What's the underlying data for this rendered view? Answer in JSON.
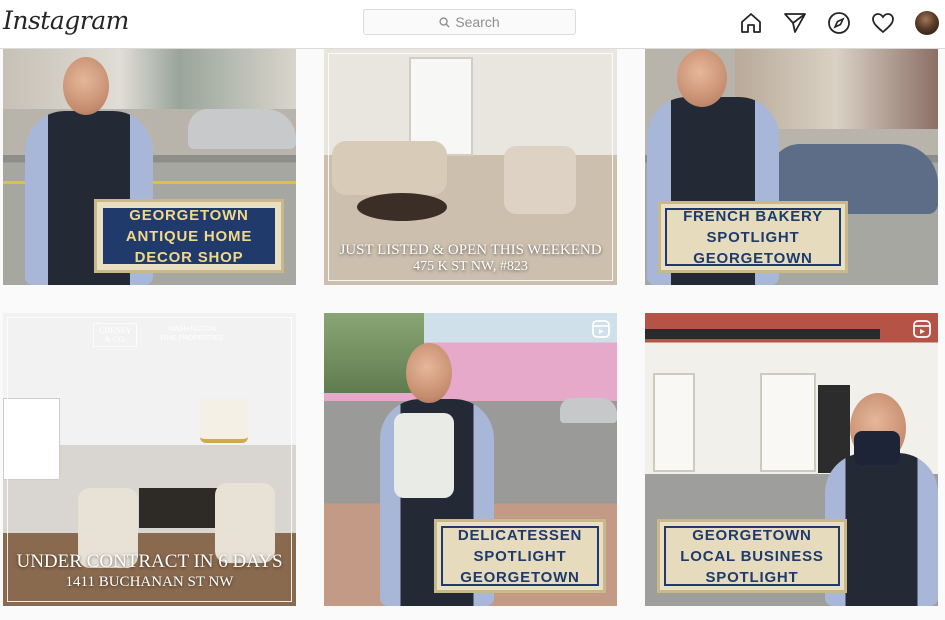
{
  "header": {
    "logo": "Instagram",
    "search_placeholder": "Search",
    "icons": [
      "home-icon",
      "direct-icon",
      "explore-icon",
      "activity-icon",
      "profile-avatar"
    ]
  },
  "posts": [
    {
      "id": "p1",
      "sign": "GEORGETOWN\nANTIQUE HOME\nDECOR SHOP",
      "style": "blue"
    },
    {
      "id": "p2",
      "line1": "JUST LISTED & OPEN THIS WEEKEND",
      "line2": "475 K ST NW, #823"
    },
    {
      "id": "p3",
      "sign": "FRENCH BAKERY\nSPOTLIGHT\nGEORGETOWN",
      "style": "cream"
    },
    {
      "id": "p4",
      "line1": "UNDER CONTRACT IN 6 DAYS",
      "line2": "1411 BUCHANAN ST NW",
      "brand1": "CHENEY\n& CO.",
      "brand2": "WASHINGTON\nFINE PROPERTIES"
    },
    {
      "id": "p5",
      "sign": "DELICATESSEN\nSPOTLIGHT\nGEORGETOWN",
      "style": "cream",
      "reel": true
    },
    {
      "id": "p6",
      "sign": "GEORGETOWN\nLOCAL BUSINESS\nSPOTLIGHT",
      "style": "cream",
      "reel": true
    }
  ],
  "colors": {
    "sign_navy": "#1f3a6b",
    "sign_gold": "#f0d98a",
    "sign_cream": "#e6dcbd"
  }
}
